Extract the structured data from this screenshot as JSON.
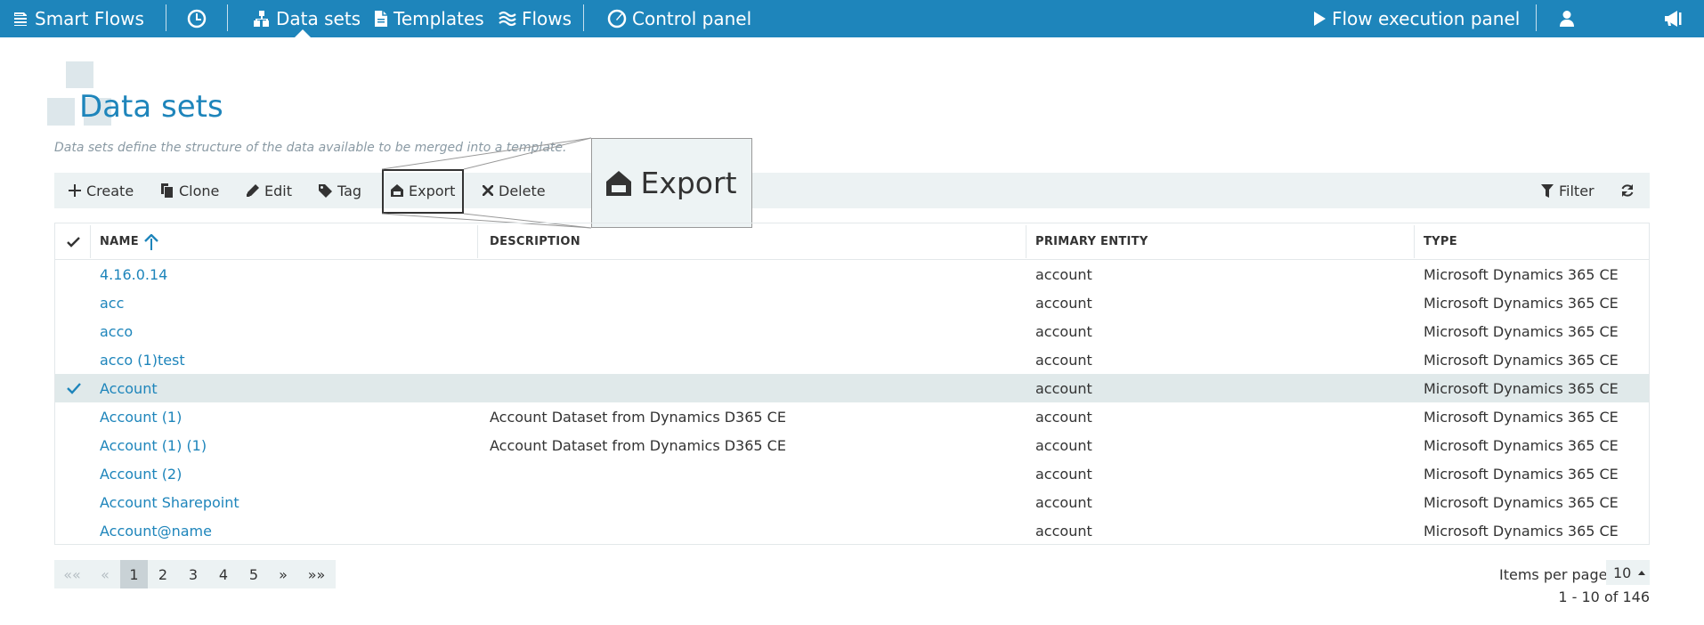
{
  "nav": {
    "app_name": "Smart Flows",
    "items": [
      {
        "label": "Data sets",
        "icon": "sitemap-icon",
        "active": true
      },
      {
        "label": "Templates",
        "icon": "file-icon"
      },
      {
        "label": "Flows",
        "icon": "waves-icon"
      },
      {
        "label": "Control panel",
        "icon": "gauge-icon"
      }
    ],
    "flow_panel_label": "Flow execution panel"
  },
  "header": {
    "title": "Data sets",
    "description": "Data sets define the structure of the data available to be merged into a template."
  },
  "toolbar": {
    "create": "Create",
    "clone": "Clone",
    "edit": "Edit",
    "tag": "Tag",
    "export": "Export",
    "delete": "Delete",
    "filter": "Filter"
  },
  "zoom": {
    "label": "Export"
  },
  "table": {
    "columns": [
      "NAME",
      "DESCRIPTION",
      "PRIMARY ENTITY",
      "TYPE"
    ],
    "sort": {
      "column": "NAME",
      "direction": "ascending"
    },
    "rows": [
      {
        "name": "4.16.0.14",
        "description": "",
        "entity": "account",
        "type": "Microsoft Dynamics 365 CE",
        "selected": false
      },
      {
        "name": "acc",
        "description": "",
        "entity": "account",
        "type": "Microsoft Dynamics 365 CE",
        "selected": false
      },
      {
        "name": "acco",
        "description": "",
        "entity": "account",
        "type": "Microsoft Dynamics 365 CE",
        "selected": false
      },
      {
        "name": "acco (1)test",
        "description": "",
        "entity": "account",
        "type": "Microsoft Dynamics 365 CE",
        "selected": false
      },
      {
        "name": "Account",
        "description": "",
        "entity": "account",
        "type": "Microsoft Dynamics 365 CE",
        "selected": true
      },
      {
        "name": "Account (1)",
        "description": "Account Dataset from Dynamics D365 CE",
        "entity": "account",
        "type": "Microsoft Dynamics 365 CE",
        "selected": false
      },
      {
        "name": "Account (1) (1)",
        "description": "Account Dataset from Dynamics D365 CE",
        "entity": "account",
        "type": "Microsoft Dynamics 365 CE",
        "selected": false
      },
      {
        "name": "Account (2)",
        "description": "",
        "entity": "account",
        "type": "Microsoft Dynamics 365 CE",
        "selected": false
      },
      {
        "name": "Account Sharepoint",
        "description": "",
        "entity": "account",
        "type": "Microsoft Dynamics 365 CE",
        "selected": false
      },
      {
        "name": "Account@name",
        "description": "",
        "entity": "account",
        "type": "Microsoft Dynamics 365 CE",
        "selected": false
      }
    ]
  },
  "pagination": {
    "first": "««",
    "prev": "«",
    "pages": [
      "1",
      "2",
      "3",
      "4",
      "5"
    ],
    "current_page": "1",
    "next": "»",
    "last": "»»",
    "items_per_page_label": "Items per page",
    "items_per_page": "10",
    "range": "1 - 10 of 146"
  },
  "colors": {
    "accent": "#1e85bb",
    "toolbar_bg": "#ecf2f3",
    "selected_row": "#e0e9ea",
    "header_deco": "#dde7eb"
  }
}
